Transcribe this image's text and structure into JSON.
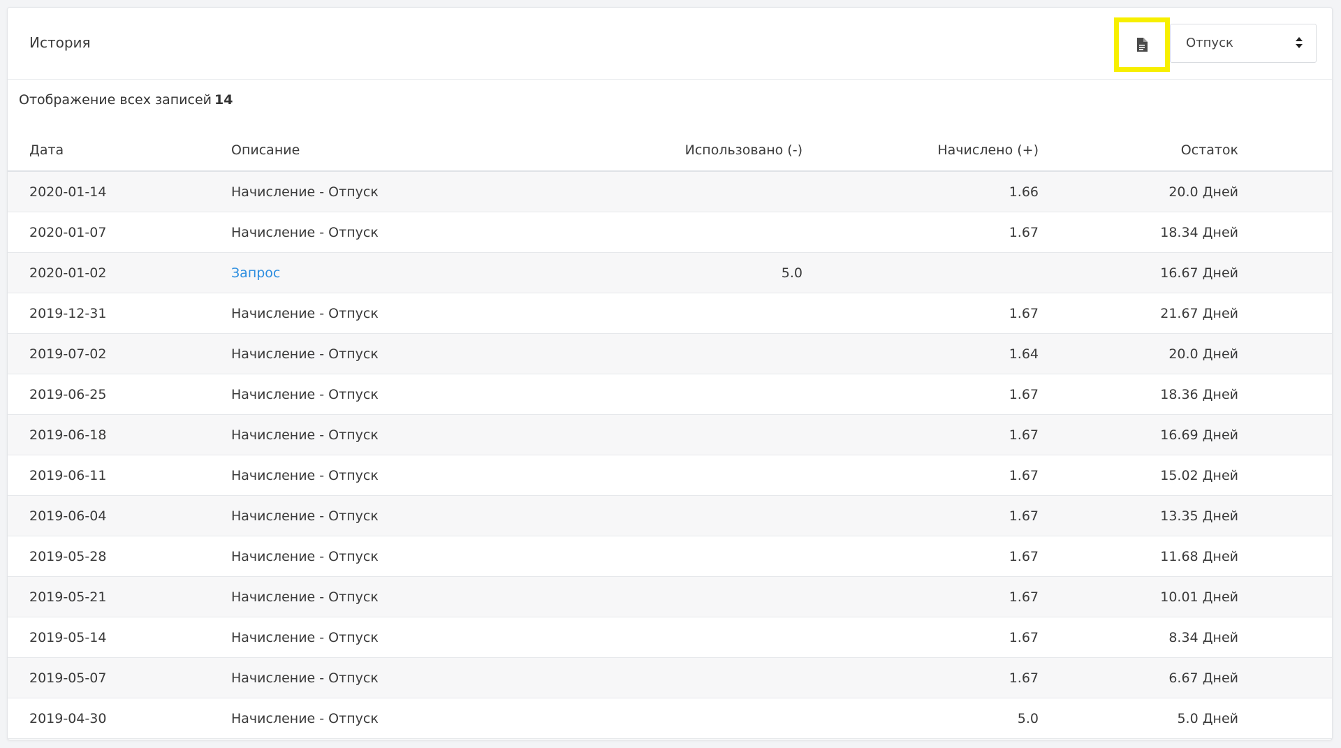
{
  "header": {
    "title": "История",
    "export_icon": "file-icon",
    "type_select": {
      "value": "Отпуск",
      "caret_icon": "sort-caret-icon"
    },
    "highlight_color": "#f7ef00"
  },
  "summary": {
    "text": "Отображение всех записей",
    "count": "14"
  },
  "table": {
    "columns": [
      "Дата",
      "Описание",
      "Использовано (-)",
      "Начислено (+)",
      "Остаток"
    ],
    "rows": [
      {
        "date": "2020-01-14",
        "description": "Начисление - Отпуск",
        "used": "",
        "accrued": "1.66",
        "balance": "20.0 Дней",
        "link": false
      },
      {
        "date": "2020-01-07",
        "description": "Начисление - Отпуск",
        "used": "",
        "accrued": "1.67",
        "balance": "18.34 Дней",
        "link": false
      },
      {
        "date": "2020-01-02",
        "description": "Запрос",
        "used": "5.0",
        "accrued": "",
        "balance": "16.67 Дней",
        "link": true
      },
      {
        "date": "2019-12-31",
        "description": "Начисление - Отпуск",
        "used": "",
        "accrued": "1.67",
        "balance": "21.67 Дней",
        "link": false
      },
      {
        "date": "2019-07-02",
        "description": "Начисление - Отпуск",
        "used": "",
        "accrued": "1.64",
        "balance": "20.0 Дней",
        "link": false
      },
      {
        "date": "2019-06-25",
        "description": "Начисление - Отпуск",
        "used": "",
        "accrued": "1.67",
        "balance": "18.36 Дней",
        "link": false
      },
      {
        "date": "2019-06-18",
        "description": "Начисление - Отпуск",
        "used": "",
        "accrued": "1.67",
        "balance": "16.69 Дней",
        "link": false
      },
      {
        "date": "2019-06-11",
        "description": "Начисление - Отпуск",
        "used": "",
        "accrued": "1.67",
        "balance": "15.02 Дней",
        "link": false
      },
      {
        "date": "2019-06-04",
        "description": "Начисление - Отпуск",
        "used": "",
        "accrued": "1.67",
        "balance": "13.35 Дней",
        "link": false
      },
      {
        "date": "2019-05-28",
        "description": "Начисление - Отпуск",
        "used": "",
        "accrued": "1.67",
        "balance": "11.68 Дней",
        "link": false
      },
      {
        "date": "2019-05-21",
        "description": "Начисление - Отпуск",
        "used": "",
        "accrued": "1.67",
        "balance": "10.01 Дней",
        "link": false
      },
      {
        "date": "2019-05-14",
        "description": "Начисление - Отпуск",
        "used": "",
        "accrued": "1.67",
        "balance": "8.34 Дней",
        "link": false
      },
      {
        "date": "2019-05-07",
        "description": "Начисление - Отпуск",
        "used": "",
        "accrued": "1.67",
        "balance": "6.67 Дней",
        "link": false
      },
      {
        "date": "2019-04-30",
        "description": "Начисление - Отпуск",
        "used": "",
        "accrued": "5.0",
        "balance": "5.0 Дней",
        "link": false
      }
    ]
  },
  "colors": {
    "link": "#2d8ee0",
    "row_stripe": "#f7f7f8"
  }
}
